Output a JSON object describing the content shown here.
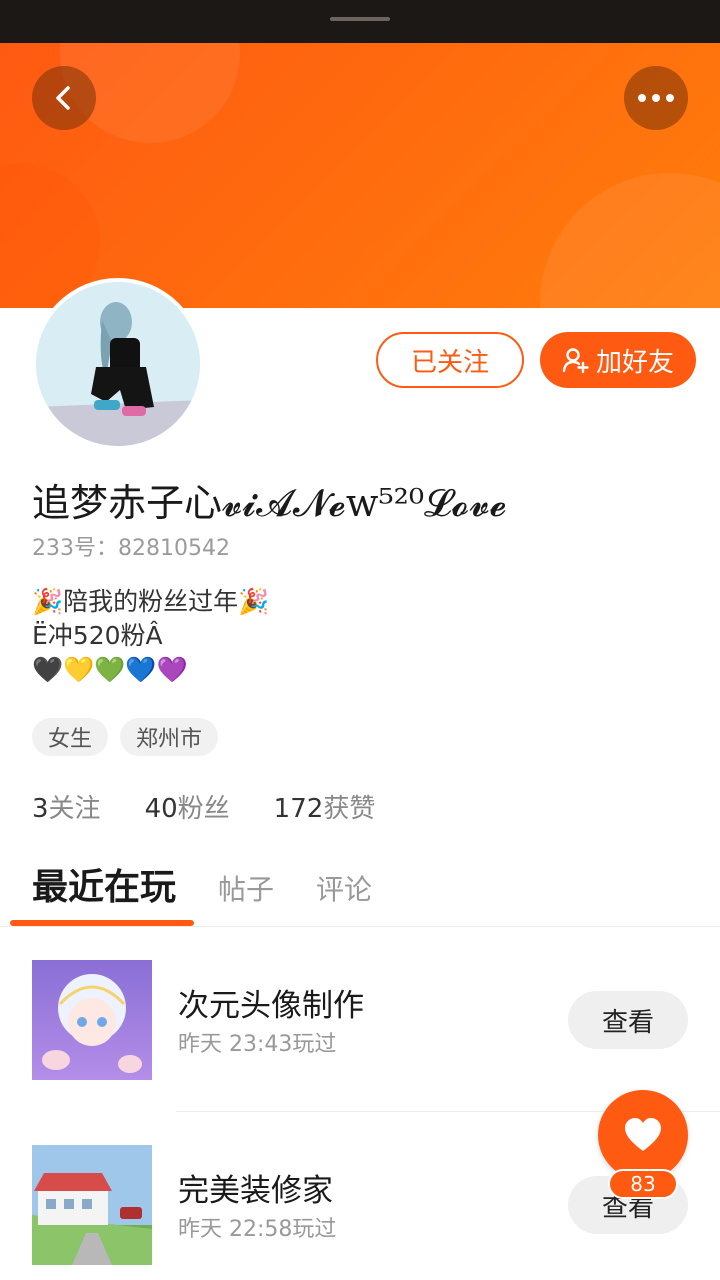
{
  "header": {
    "back_icon": "chevron-left-icon",
    "more_icon": "more-dots-icon"
  },
  "profile": {
    "username": "追梦赤子心𝓿𝓲𝓐𝓝𝓮w⁵²⁰𝓛𝓸𝓿𝓮",
    "user_id": "233号：82810542",
    "bio": "🎉陪我的粉丝过年🎉\nË冲520粉Â\n🖤💛💚💙💜",
    "tags": [
      "女生",
      "郑州市"
    ],
    "follow_label": "已关注",
    "add_friend_label": "加好友",
    "add_friend_icon": "add-user-icon"
  },
  "stats": [
    {
      "num": "3",
      "label": "关注"
    },
    {
      "num": "40",
      "label": "粉丝"
    },
    {
      "num": "172",
      "label": "获赞"
    }
  ],
  "tabs": [
    "最近在玩",
    "帖子",
    "评论"
  ],
  "games": [
    {
      "title": "次元头像制作",
      "time": "昨天 23:43玩过",
      "button": "查看"
    },
    {
      "title": "完美装修家",
      "time": "昨天 22:58玩过",
      "button": "查看"
    }
  ],
  "fab": {
    "icon": "heart-icon",
    "count": "83"
  },
  "colors": {
    "accent": "#ff5a12",
    "banner_end": "#ff7d0c"
  }
}
